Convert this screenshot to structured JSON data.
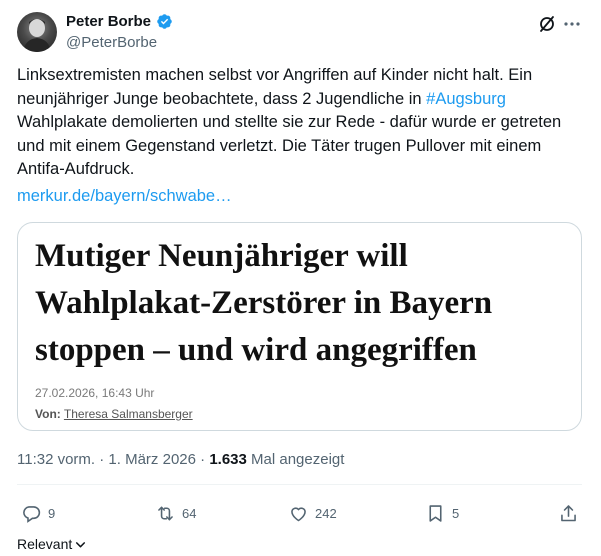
{
  "author": {
    "display_name": "Peter Borbe",
    "handle": "@PeterBorbe",
    "verified": true
  },
  "tweet": {
    "text_before_hashtag": "Linksextremisten machen selbst vor Angriffen auf Kinder nicht halt. Ein neunjähriger Junge beobachtete, dass 2 Jugendliche in ",
    "hashtag": "#Augsburg",
    "text_after_hashtag": "\nWahlplakate demolierten und stellte sie zur Rede - dafür wurde er getreten und mit einem Gegenstand verletzt. Die Täter trugen Pullover mit einem Antifa-Aufdruck.",
    "link": "merkur.de/bayern/schwabe…"
  },
  "card": {
    "headline": "Mutiger Neunjähriger will\nWahlplakat-Zerstörer in Bayern\nstoppen – und wird angegriffen",
    "date": "27.02.2026, 16:43 Uhr",
    "author_label": "Von:",
    "author_name": "Theresa Salmansberger"
  },
  "meta": {
    "time_date": "11:32 vorm. · 1. März 2026 · ",
    "views_count": "1.633",
    "views_label": " Mal angezeigt"
  },
  "actions": {
    "replies": "9",
    "reposts": "64",
    "likes": "242",
    "bookmarks": "5"
  },
  "sort": {
    "label": "Relevant"
  },
  "colors": {
    "accent": "#1d9bf0",
    "text": "#0f1419",
    "secondary": "#536471",
    "border": "#cfd9de"
  }
}
